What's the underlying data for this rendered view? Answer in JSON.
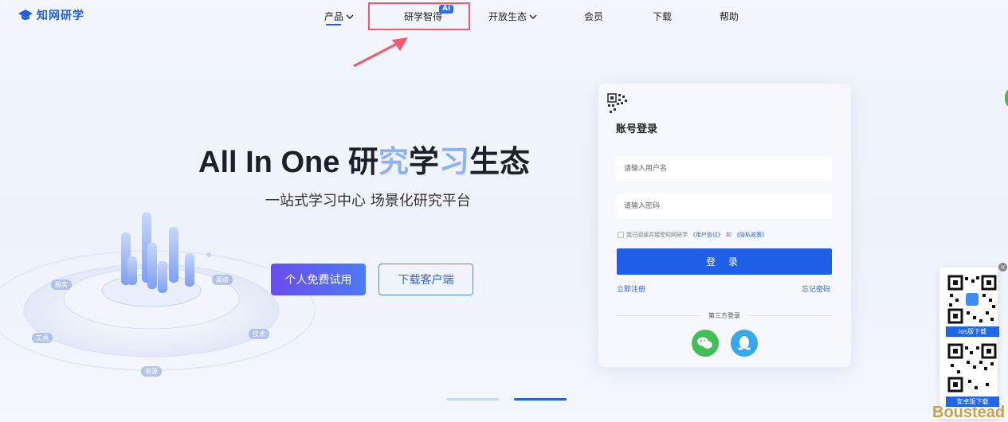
{
  "header": {
    "logo_text": "知网研学",
    "nav": [
      {
        "label": "产品",
        "has_dropdown": true
      },
      {
        "label": "研学智得",
        "badge": "AI"
      },
      {
        "label": "开放生态",
        "has_dropdown": true
      },
      {
        "label": "会员"
      },
      {
        "label": "下载"
      },
      {
        "label": "帮助"
      }
    ]
  },
  "hero": {
    "title_prefix": "All In One 研",
    "title_h1": "究",
    "title_mid": "学",
    "title_h2": "习",
    "title_suffix": "生态",
    "subtitle": "一站式学习中心 场景化研究平台",
    "trial_button": "个人免费试用",
    "download_button": "下载客户端",
    "illustration_tags": [
      "服务",
      "渠道",
      "工具",
      "技术",
      "资源"
    ]
  },
  "login": {
    "title": "账号登录",
    "username_placeholder": "请输入用户名",
    "password_placeholder": "请输入密码",
    "agree_prefix": "我已阅读并接受知网研学",
    "user_agreement": "《用户协议》",
    "and": "和",
    "privacy_policy": "《隐私政策》",
    "login_button": "登 录",
    "register_link": "立即注册",
    "forgot_link": "忘记密码",
    "third_party_label": "第三方登录"
  },
  "side": {
    "ios_label": "ios版下载",
    "android_label": "安卓版下载",
    "close": "×",
    "brand": "Boustead"
  },
  "colors": {
    "primary": "#1f5fe8",
    "highlight": "#8fb2f5",
    "annotation_red": "#f05a6a"
  }
}
